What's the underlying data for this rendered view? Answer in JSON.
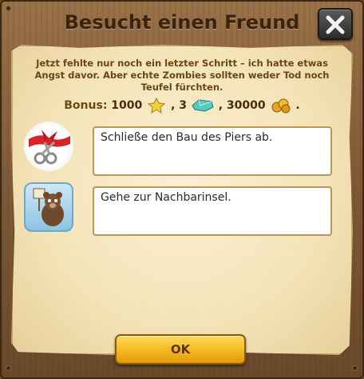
{
  "dialog": {
    "title": "Besucht einen Freund",
    "intro": "Jetzt fehlte nur noch ein letzter Schritt – ich hatte etwas Angst davor. Aber echte Zombies sollten weder Tod noch Teufel fürchten.",
    "bonus": {
      "label": "Bonus:",
      "xp": "1000",
      "gems": "3",
      "coins": "30000",
      "sep1": ",",
      "sep2": ",",
      "end": "."
    },
    "tasks": [
      {
        "text": "Schließe den Bau des Piers ab.",
        "icon": "ribbon-scissors-icon"
      },
      {
        "text": "Gehe zur Nachbarinsel.",
        "icon": "bear-sign-icon"
      }
    ],
    "ok_label": "OK"
  },
  "colors": {
    "wood": "#7e5a36",
    "parchment": "#f4e3b8",
    "button": "#f5b81f",
    "title_text": "#3a2410"
  }
}
